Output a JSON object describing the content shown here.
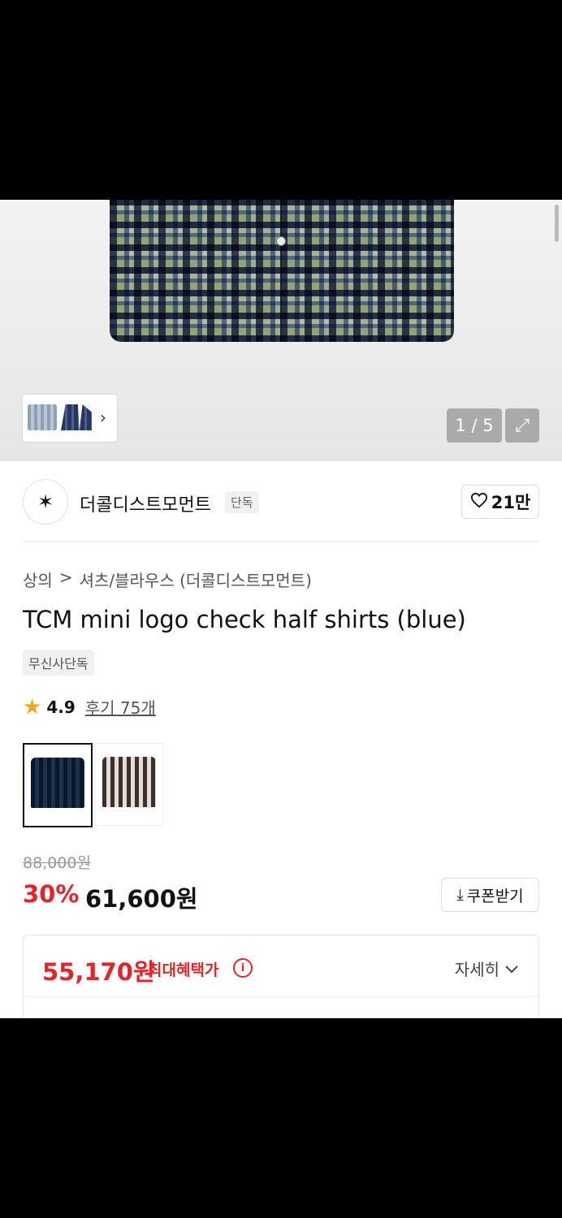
{
  "gallery": {
    "pager": "1 / 5",
    "expand_icon": "expand-icon",
    "thumb_chevron": "›"
  },
  "brand": {
    "name": "더콜디스트모먼트",
    "tag": "단독",
    "logo_glyph": "✶",
    "like_count": "21만"
  },
  "breadcrumb": {
    "level1": "상의",
    "separator": ">",
    "level2": "셔츠/블라우스 (더콜디스트모먼트)"
  },
  "product": {
    "title": "TCM mini logo check half shirts (blue)",
    "exclusive_tag": "무신사단독",
    "rating": "4.9",
    "reviews_label": "후기 75개"
  },
  "price": {
    "original": "88,000원",
    "discount": "30%",
    "sale": "61,600원",
    "coupon_label": "쿠폰받기"
  },
  "benefit": {
    "price": "55,170원",
    "label": "최대혜택가",
    "detail_label": "자세히"
  },
  "colors": {
    "accent_red": "#e3242b",
    "star": "#f5a623"
  }
}
